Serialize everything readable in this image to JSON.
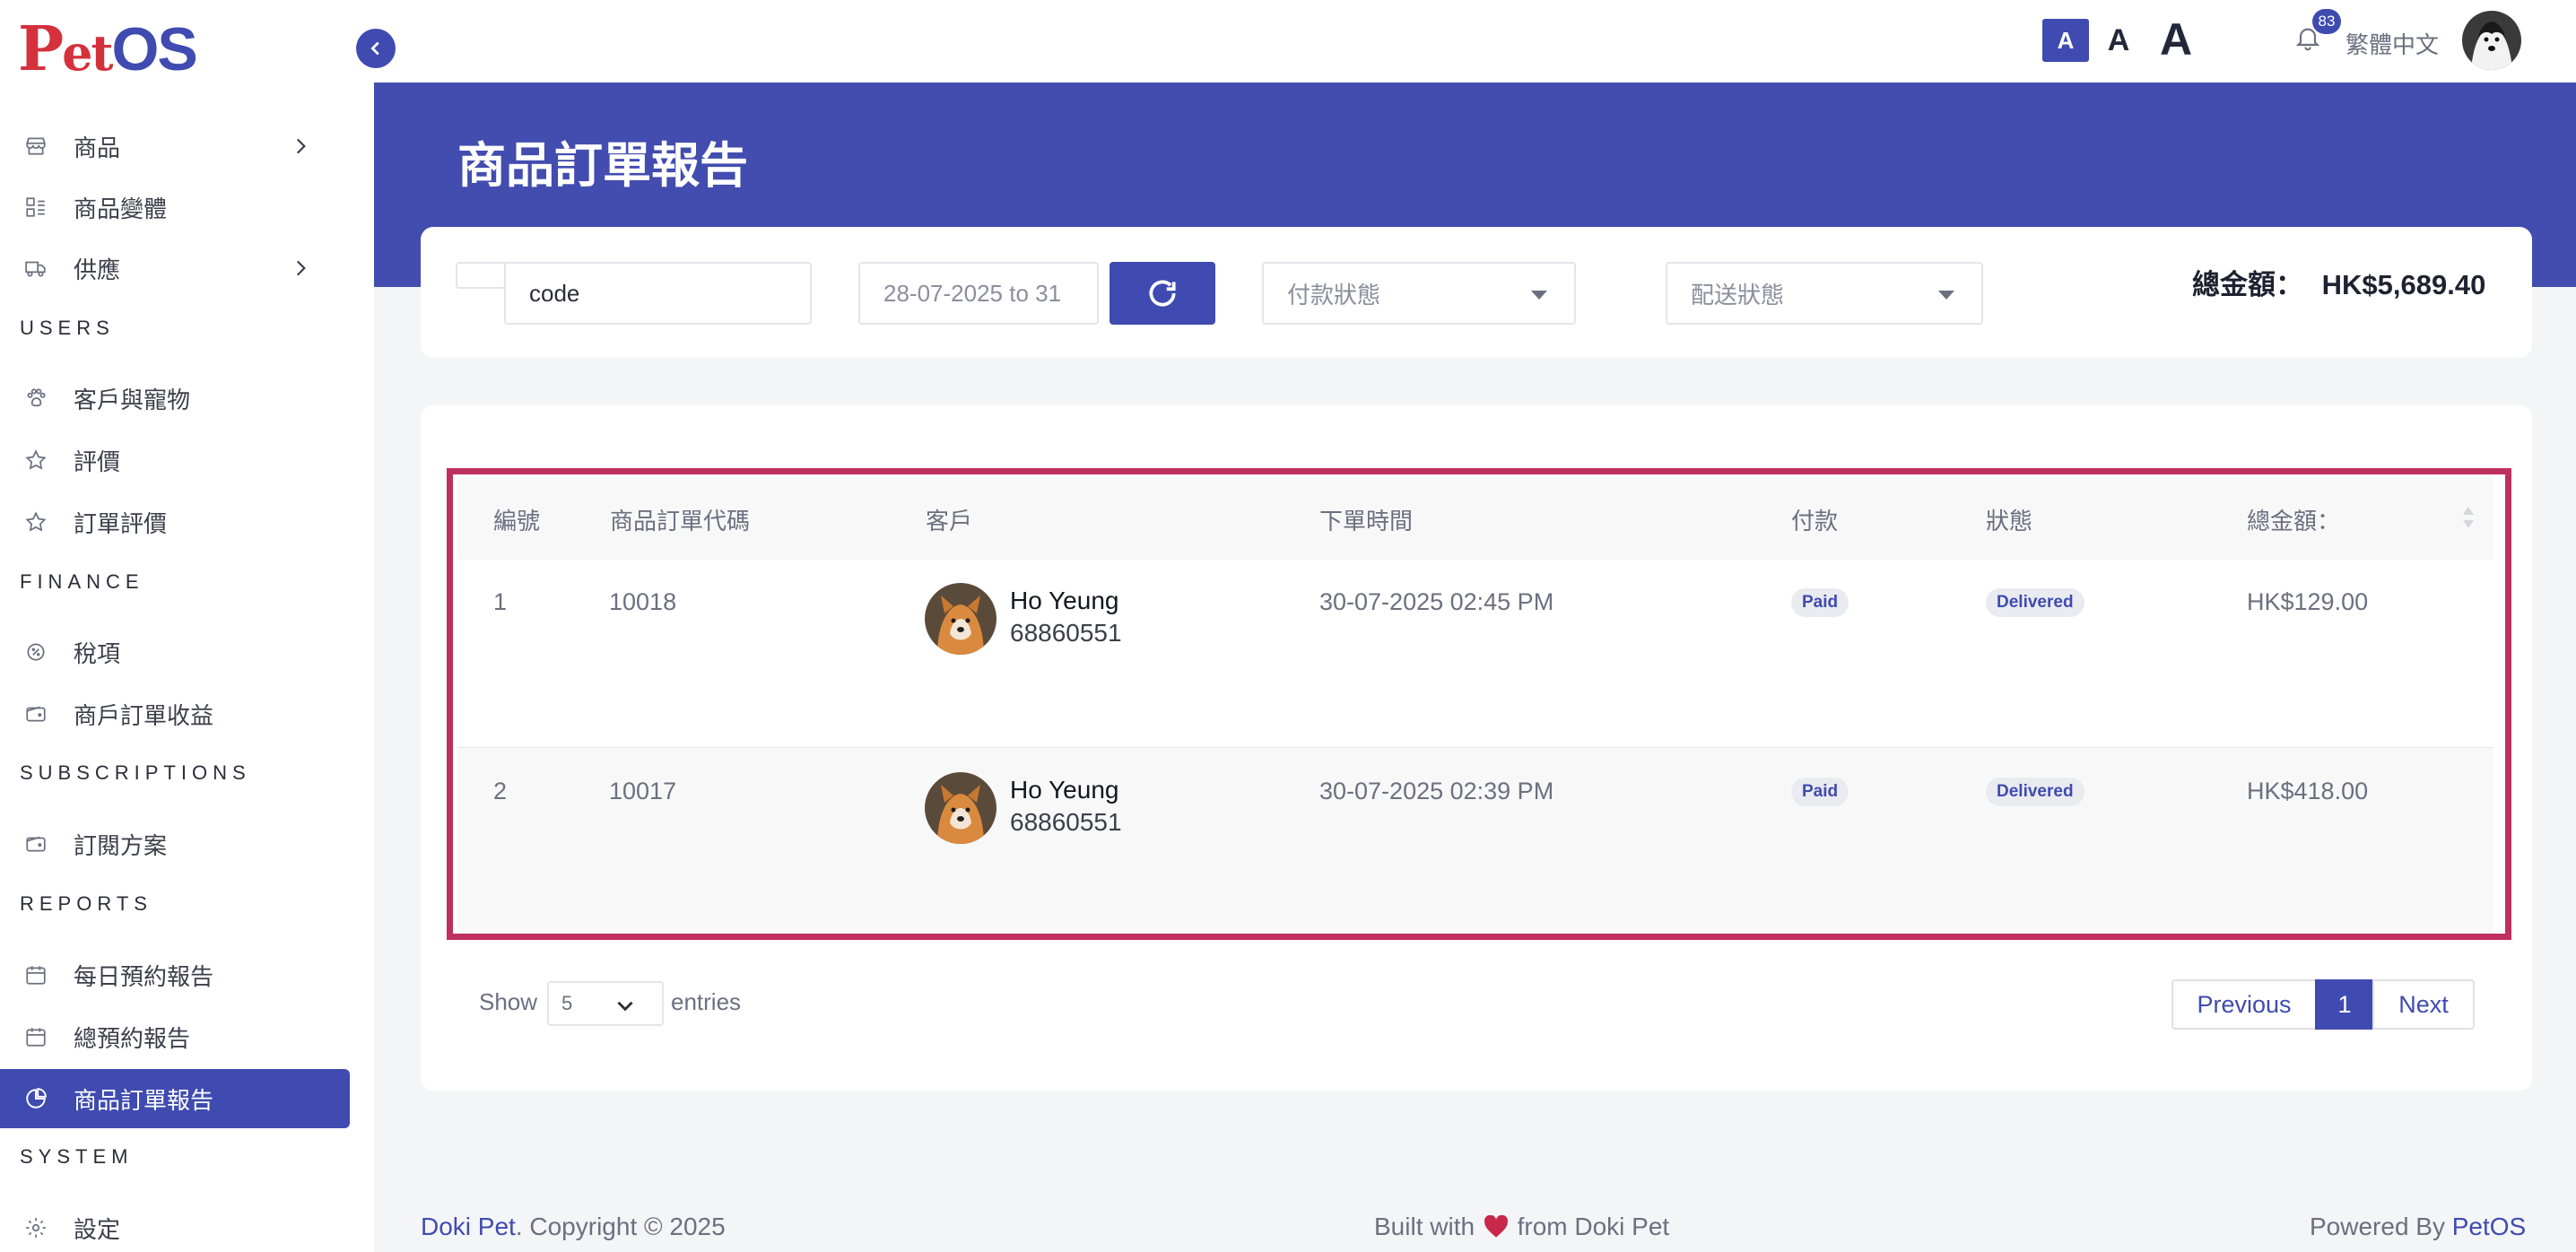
{
  "brand": {
    "logo_p": "P",
    "logo_et": "et",
    "logo_os": "OS"
  },
  "sidebar": {
    "items": [
      {
        "label": "商品",
        "icon": "shop-icon",
        "has_chevron": true
      },
      {
        "label": "商品變體",
        "icon": "variants-icon"
      },
      {
        "label": "供應",
        "icon": "truck-icon",
        "has_chevron": true
      }
    ],
    "sections": [
      "USERS",
      "FINANCE",
      "SUBSCRIPTIONS",
      "REPORTS",
      "SYSTEM"
    ],
    "users": [
      {
        "label": "客戶與寵物",
        "icon": "paw-icon"
      },
      {
        "label": "評價",
        "icon": "star-icon"
      },
      {
        "label": "訂單評價",
        "icon": "star-icon"
      }
    ],
    "finance": [
      {
        "label": "稅項",
        "icon": "tax-icon"
      },
      {
        "label": "商戶訂單收益",
        "icon": "wallet-icon"
      }
    ],
    "subscriptions": [
      {
        "label": "訂閱方案",
        "icon": "wallet-icon"
      }
    ],
    "reports": [
      {
        "label": "每日預約報告",
        "icon": "calendar-icon"
      },
      {
        "label": "總預約報告",
        "icon": "calendar-icon"
      },
      {
        "label": "商品訂單報告",
        "icon": "pie-chart-icon",
        "active": true
      }
    ],
    "system": [
      {
        "label": "設定",
        "icon": "gear-icon"
      }
    ]
  },
  "topbar": {
    "font_sizes": [
      "A",
      "A",
      "A"
    ],
    "notification_count": "83",
    "language": "繁體中文"
  },
  "page": {
    "title": "商品訂單報告"
  },
  "filters": {
    "code_value": "code",
    "date_range": "28-07-2025 to 31",
    "payment_status_placeholder": "付款狀態",
    "delivery_status_placeholder": "配送狀態",
    "total_label": "總金額：",
    "total_value": "HK$5,689.40"
  },
  "table": {
    "headers": [
      "編號",
      "商品訂單代碼",
      "客戶",
      "下單時間",
      "付款",
      "狀態",
      "總金額："
    ],
    "rows": [
      {
        "no": "1",
        "code": "10018",
        "customer_name": "Ho Yeung",
        "customer_phone": "68860551",
        "time": "30-07-2025 02:45 PM",
        "payment": "Paid",
        "status": "Delivered",
        "total": "HK$129.00"
      },
      {
        "no": "2",
        "code": "10017",
        "customer_name": "Ho Yeung",
        "customer_phone": "68860551",
        "time": "30-07-2025 02:39 PM",
        "payment": "Paid",
        "status": "Delivered",
        "total": "HK$418.00"
      }
    ]
  },
  "pagination": {
    "show_label": "Show",
    "page_size": "5",
    "entries_label": "entries",
    "previous": "Previous",
    "current": "1",
    "next": "Next"
  },
  "footer": {
    "company": "Doki Pet",
    "copyright": ". Copyright © 2025",
    "built_prefix": "Built with",
    "built_suffix": "from Doki Pet",
    "powered_prefix": "Powered By ",
    "powered_brand": "PetOS"
  },
  "colors": {
    "primary": "#3f4bb0",
    "highlight": "#c0305e",
    "logo_red": "#d4313d",
    "heart": "#c8284a"
  }
}
